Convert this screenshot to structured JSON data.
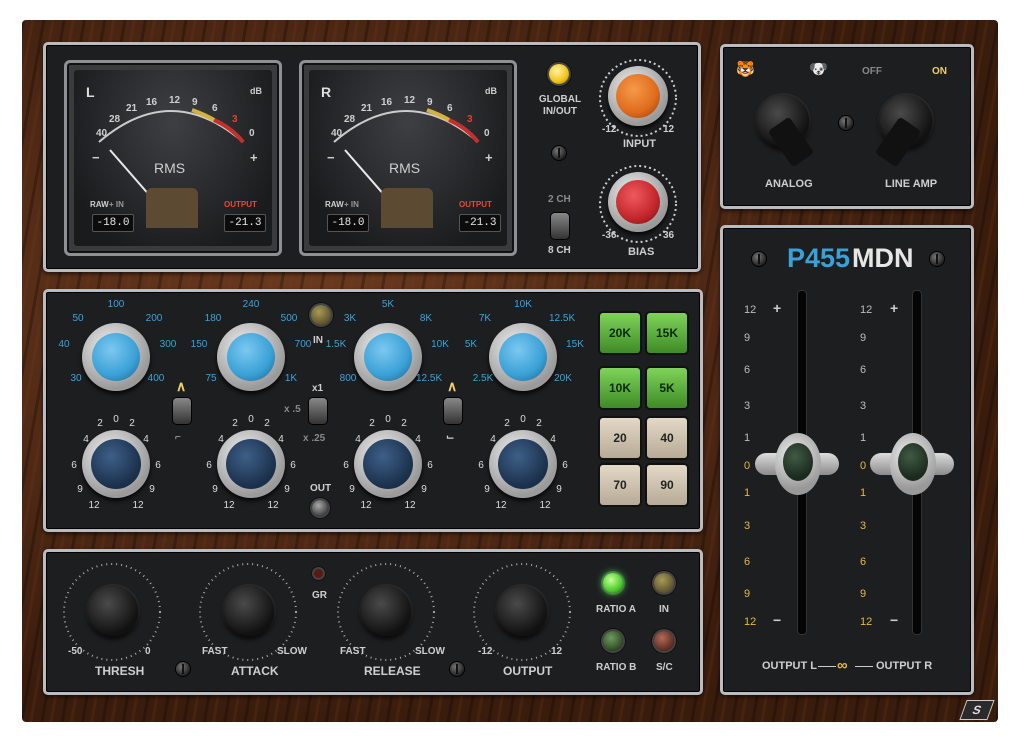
{
  "meters": [
    {
      "channel": "L",
      "db": "dB",
      "scale": [
        "40",
        "28",
        "21",
        "16",
        "12",
        "9",
        "6",
        "3",
        "0"
      ],
      "rms": "RMS",
      "minus": "−",
      "plus": "+",
      "left_label_a": "RAW",
      "left_label_b": "+ IN",
      "left_value": "-18.0",
      "right_label": "OUTPUT",
      "right_value": "-21.3"
    },
    {
      "channel": "R",
      "db": "dB",
      "scale": [
        "40",
        "28",
        "21",
        "16",
        "12",
        "9",
        "6",
        "3",
        "0"
      ],
      "rms": "RMS",
      "minus": "−",
      "plus": "+",
      "left_label_a": "RAW",
      "left_label_b": "+ IN",
      "left_value": "-18.0",
      "right_label": "OUTPUT",
      "right_value": "-21.3"
    }
  ],
  "top": {
    "global": "GLOBAL\nIN/OUT",
    "ch2": "2 CH",
    "ch8": "8 CH",
    "input": "INPUT",
    "input_min": "-12",
    "input_max": "12",
    "bias": "BIAS",
    "bias_min": "-36",
    "bias_max": "36",
    "lamp_color": "#f2c21a",
    "input_color": "#e06a1c",
    "bias_color": "#c2262b"
  },
  "amp": {
    "off": "OFF",
    "on": "ON",
    "analog": "ANALOG",
    "line_amp": "LINE AMP",
    "icon_left": "tiger-icon",
    "icon_mid": "dog-icon"
  },
  "eq": {
    "freq_knobs": [
      {
        "labels": [
          "100",
          "50",
          "200",
          "40",
          "300",
          "30",
          "400"
        ]
      },
      {
        "labels": [
          "240",
          "180",
          "500",
          "150",
          "700",
          "75",
          "1K"
        ]
      },
      {
        "labels": [
          "5K",
          "3K",
          "8K",
          "1.5K",
          "10K",
          "800",
          "12.5K"
        ]
      },
      {
        "labels": [
          "10K",
          "7K",
          "12.5K",
          "5K",
          "15K",
          "2.5K",
          "20K"
        ]
      }
    ],
    "gain_scale": [
      "2",
      "0",
      "2",
      "4",
      "4",
      "6",
      "6",
      "9",
      "9",
      "12",
      "12"
    ],
    "in": "IN",
    "x1": "x1",
    "x5": "x .5",
    "x25": "x .25",
    "out": "OUT",
    "buttons": [
      [
        "20K",
        "15K"
      ],
      [
        "10K",
        "5K"
      ],
      [
        "20",
        "40"
      ],
      [
        "70",
        "90"
      ]
    ],
    "blue_color": "#3aa0d6"
  },
  "comp": {
    "thresh": "THRESH",
    "thresh_min": "-50",
    "thresh_max": "0",
    "attack": "ATTACK",
    "release": "RELEASE",
    "fast": "FAST",
    "slow": "SLOW",
    "output": "OUTPUT",
    "out_min": "-12",
    "out_max": "12",
    "gr": "GR",
    "ratio_a": "RATIO A",
    "ratio_b": "RATIO B",
    "in": "IN",
    "sc": "S/C"
  },
  "faders": {
    "title_a": "P455",
    "title_b": "MDN",
    "upper": [
      "12",
      "9",
      "6",
      "3",
      "1",
      "0"
    ],
    "lower": [
      "1",
      "3",
      "6",
      "9",
      "12"
    ],
    "plus": "+",
    "minus": "−",
    "out_l": "OUTPUT L",
    "out_r": "OUTPUT R",
    "link": "link-icon"
  },
  "footer": {
    "logo": "S"
  }
}
